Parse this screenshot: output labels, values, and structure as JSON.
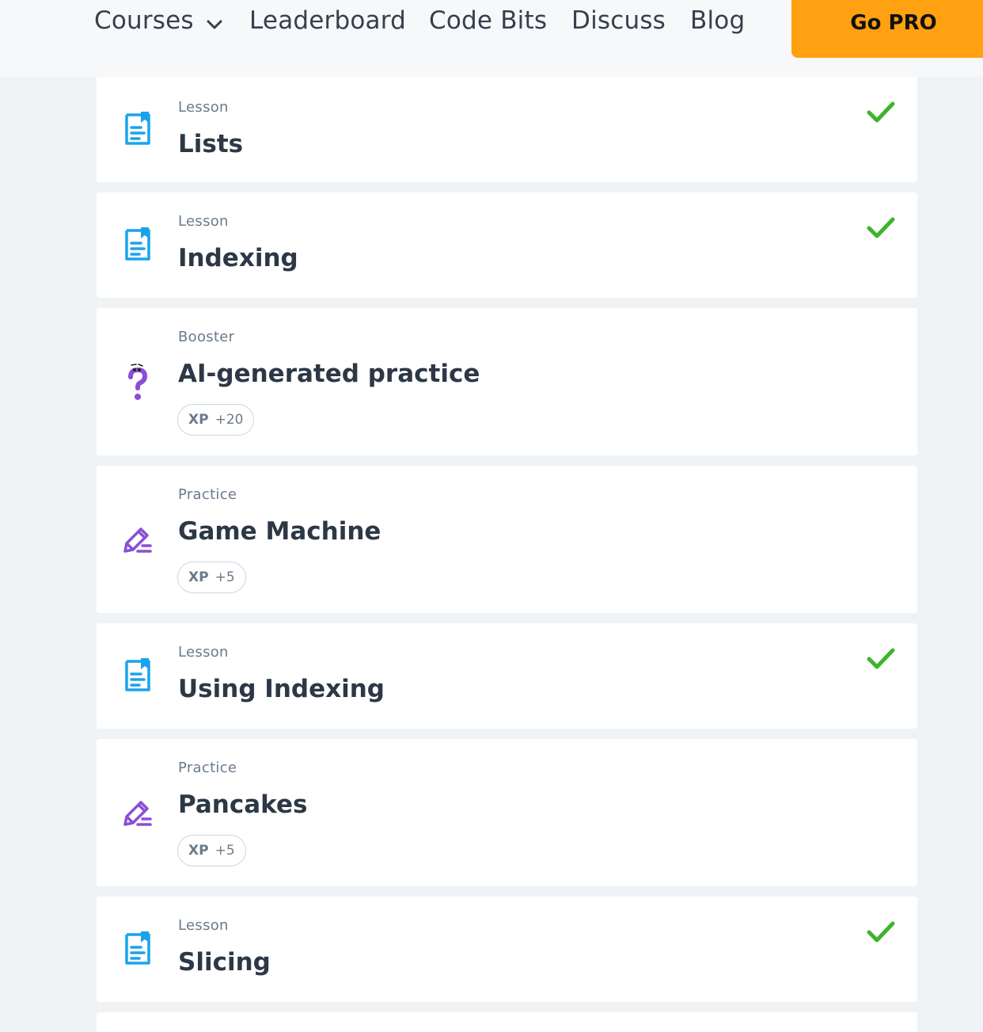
{
  "nav": {
    "items": [
      {
        "label": "Courses",
        "has_dropdown": true
      },
      {
        "label": "Leaderboard"
      },
      {
        "label": "Code Bits"
      },
      {
        "label": "Discuss"
      },
      {
        "label": "Blog"
      }
    ],
    "cta_label": "Go PRO"
  },
  "colors": {
    "accent_cta": "#ffa110",
    "lesson_icon": "#1aa3ec",
    "practice_icon": "#8a4fd6",
    "check": "#3cb52a"
  },
  "cards": [
    {
      "type": "Lesson",
      "title": "Lists",
      "icon": "lesson-document-icon",
      "completed": true
    },
    {
      "type": "Lesson",
      "title": "Indexing",
      "icon": "lesson-document-icon",
      "completed": true
    },
    {
      "type": "Booster",
      "title": "AI-generated practice",
      "icon": "question-mark-booster-icon",
      "completed": false,
      "xp_label": "XP",
      "xp_value": "+20"
    },
    {
      "type": "Practice",
      "title": "Game Machine",
      "icon": "pencil-practice-icon",
      "completed": false,
      "xp_label": "XP",
      "xp_value": "+5"
    },
    {
      "type": "Lesson",
      "title": "Using Indexing",
      "icon": "lesson-document-icon",
      "completed": true
    },
    {
      "type": "Practice",
      "title": "Pancakes",
      "icon": "pencil-practice-icon",
      "completed": false,
      "xp_label": "XP",
      "xp_value": "+5"
    },
    {
      "type": "Lesson",
      "title": "Slicing",
      "icon": "lesson-document-icon",
      "completed": true
    }
  ]
}
